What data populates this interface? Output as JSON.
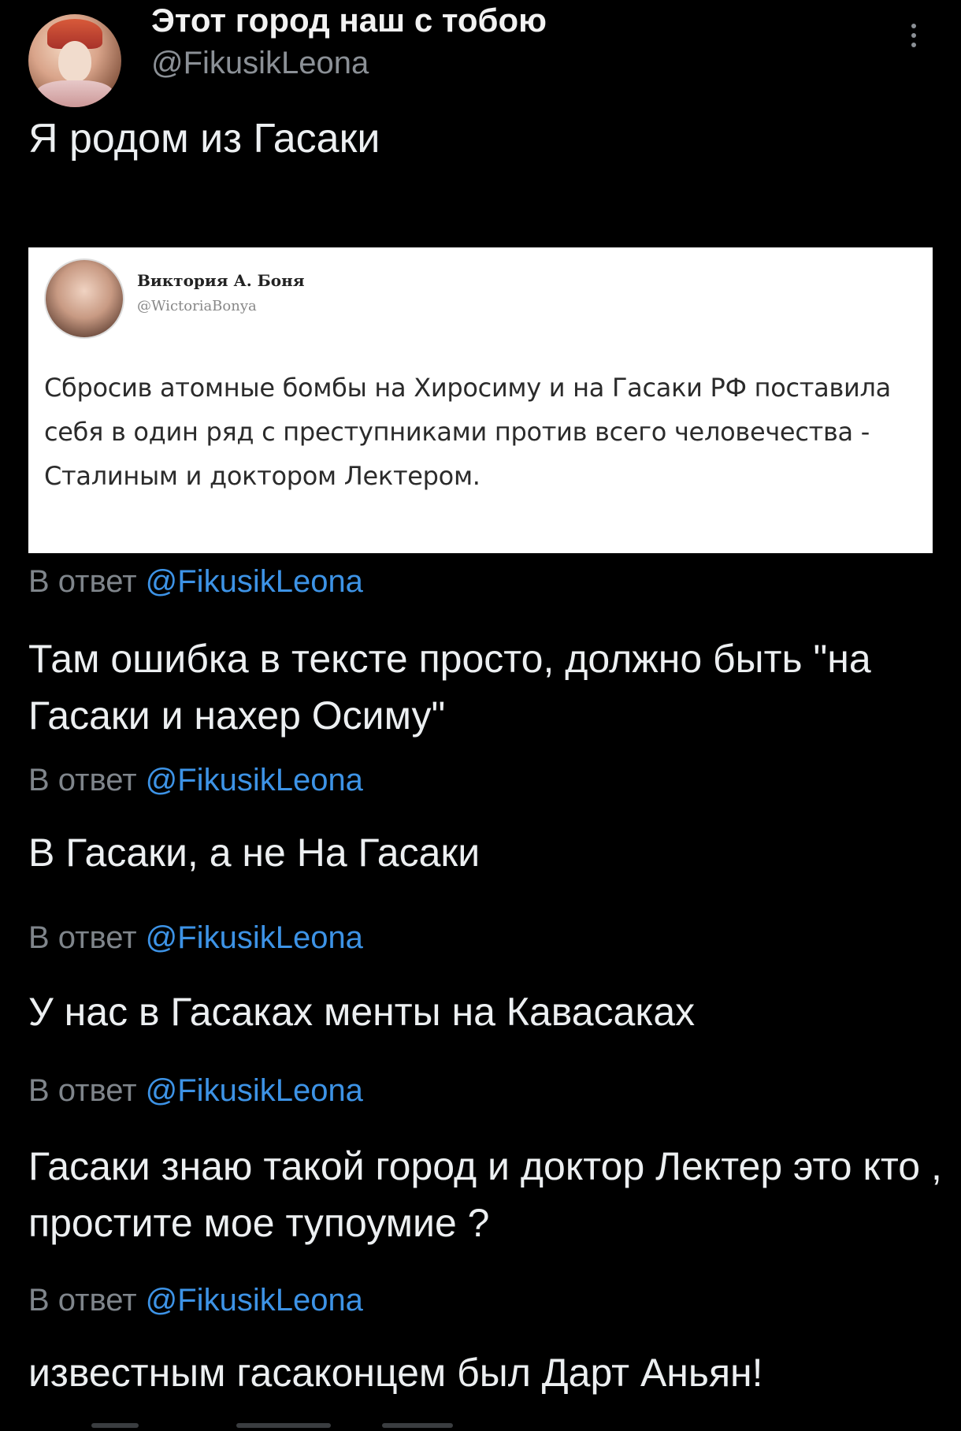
{
  "header": {
    "display_name": "Этот город наш с тобою",
    "handle": "@FikusikLeona",
    "avatar_icon": "avatar-photo",
    "more_icon": "more-vertical-icon"
  },
  "tweet": {
    "text": "Я родом из Гасаки"
  },
  "embedded_tweet": {
    "name": "Виктория А. Боня",
    "handle": "@WictoriaBonya",
    "text": "Сбросив атомные бомбы на Хиросиму и на Гасаки РФ поставила себя в один ряд с преступниками против всего человечества - Сталиным и доктором Лектером."
  },
  "replies": [
    {
      "prefix": "В ответ ",
      "mention": "@FikusikLeona",
      "text": "Там ошибка в тексте просто, должно быть \"на Гасаки и нахер Осиму\""
    },
    {
      "prefix": "В ответ ",
      "mention": "@FikusikLeona",
      "text": "В Гасаки, а не На Гасаки"
    },
    {
      "prefix": "В ответ ",
      "mention": "@FikusikLeona",
      "text": "У нас в Гасаках менты на Кавасаках"
    },
    {
      "prefix": "В ответ ",
      "mention": "@FikusikLeona",
      "text": "Гасаки знаю такой город и доктор Лектер это кто , простите мое тупоумие ?"
    },
    {
      "prefix": "В ответ ",
      "mention": "@FikusikLeona",
      "text": "известным гасаконцем был Дарт Аньян!"
    }
  ],
  "colors": {
    "background": "#000000",
    "mention": "#3d93e6",
    "muted": "#7f858b"
  }
}
